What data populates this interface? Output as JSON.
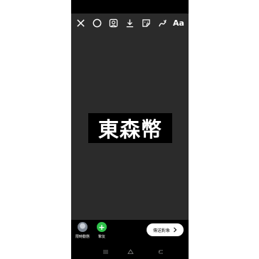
{
  "toolbar": {
    "tools": [
      {
        "icon": "close-icon"
      },
      {
        "icon": "circle-icon"
      },
      {
        "icon": "person-frame-icon"
      },
      {
        "icon": "download-icon"
      },
      {
        "icon": "sticker-icon"
      },
      {
        "icon": "brush-icon"
      },
      {
        "icon": "text-tool-icon",
        "label": "Aa"
      }
    ]
  },
  "canvas": {
    "text_sticker": "東森幣",
    "background_color": "#2b2b2b"
  },
  "bottom_bar": {
    "targets": [
      {
        "label": "限時動態",
        "icon": "avatar"
      },
      {
        "label": "摯友",
        "icon": "plus-icon",
        "color": "#2ec24a"
      }
    ],
    "send_button": {
      "label": "傳送對象",
      "icon": "chevron-right-icon"
    }
  },
  "nav_bar": {
    "buttons": [
      {
        "icon": "nav-menu-icon"
      },
      {
        "icon": "nav-home-icon"
      },
      {
        "icon": "nav-back-icon"
      }
    ]
  }
}
